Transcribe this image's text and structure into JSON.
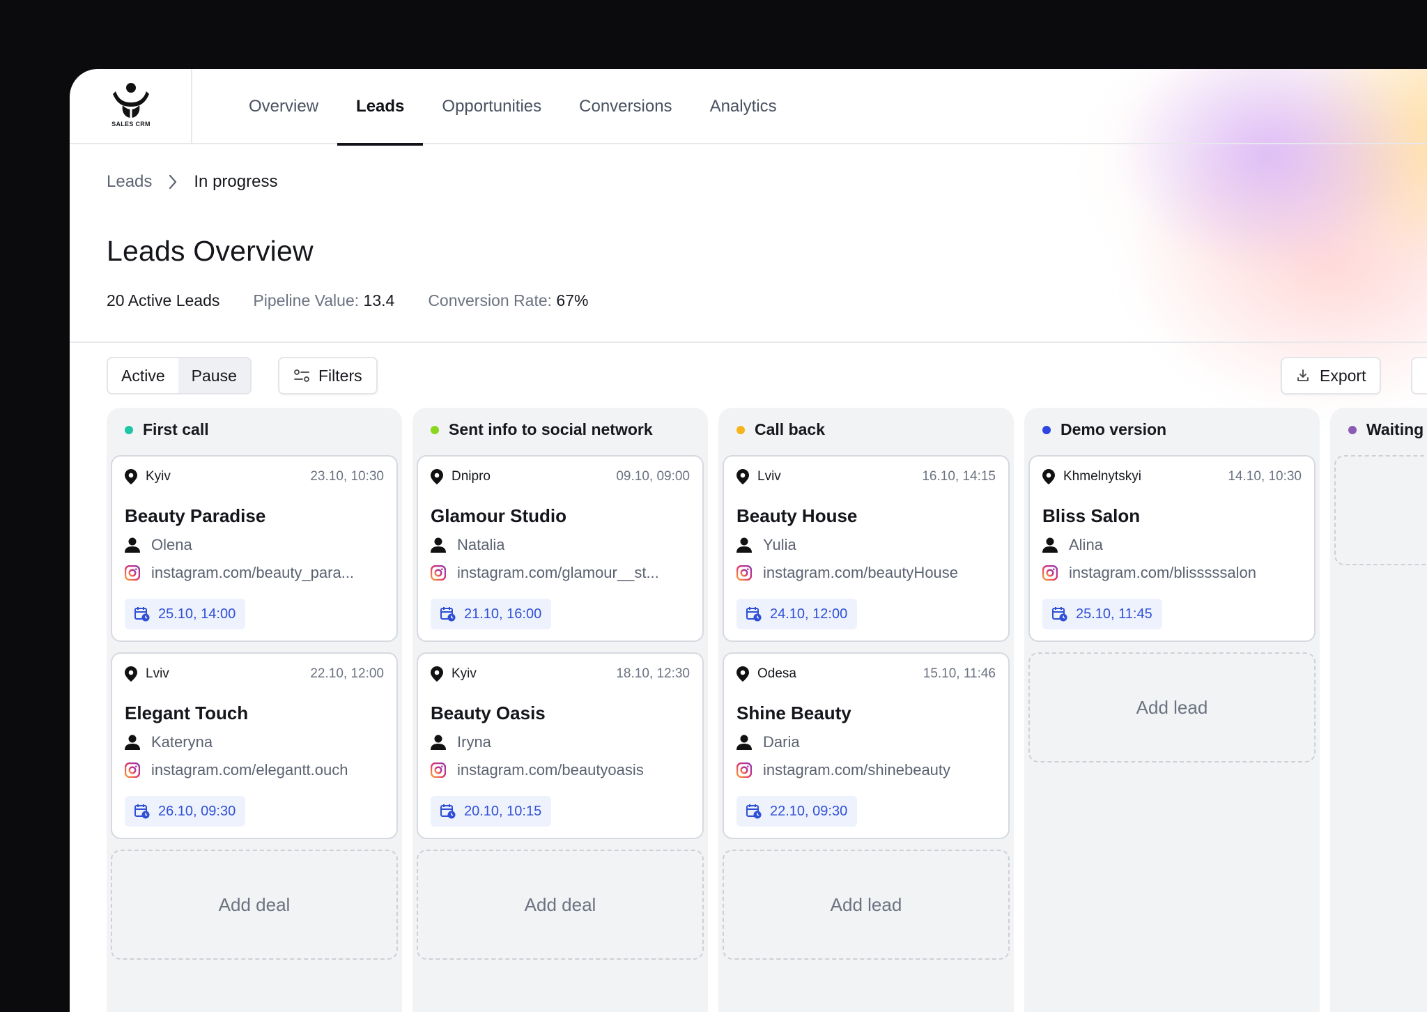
{
  "app": {
    "logo_text": "SALES CRM"
  },
  "nav": {
    "tabs": [
      {
        "label": "Overview"
      },
      {
        "label": "Leads",
        "active": true
      },
      {
        "label": "Opportunities"
      },
      {
        "label": "Conversions"
      },
      {
        "label": "Analytics"
      }
    ]
  },
  "breadcrumb": {
    "root": "Leads",
    "current": "In progress"
  },
  "page": {
    "title": "Leads Overview"
  },
  "stats": {
    "active_leads": "20 Active Leads",
    "pipeline_label": "Pipeline Value:",
    "pipeline_value": "13.4",
    "conversion_label": "Conversion Rate:",
    "conversion_value": "67%"
  },
  "toolbar": {
    "segment": {
      "active": "Active",
      "pause": "Pause"
    },
    "filters": "Filters",
    "export": "Export"
  },
  "colors": {
    "first_call": "#1cc6a6",
    "sent_info": "#8ad61c",
    "call_back": "#f5b51a",
    "demo_version": "#2f44e0",
    "waiting": "#8c5bb5",
    "badge_text": "#2f4fd6"
  },
  "columns": [
    {
      "title": "First call",
      "cards": [
        {
          "city": "Kyiv",
          "date": "23.10, 10:30",
          "name": "Beauty Paradise",
          "contact": "Olena",
          "instagram": "instagram.com/beauty_para...",
          "meeting": "25.10, 14:00"
        },
        {
          "city": "Lviv",
          "date": "22.10, 12:00",
          "name": "Elegant Touch",
          "contact": "Kateryna",
          "instagram": "instagram.com/elegantt.ouch",
          "meeting": "26.10, 09:30"
        }
      ],
      "add_label": "Add deal"
    },
    {
      "title": "Sent info to social network",
      "cards": [
        {
          "city": "Dnipro",
          "date": "09.10, 09:00",
          "name": "Glamour Studio",
          "contact": "Natalia",
          "instagram": "instagram.com/glamour__st...",
          "meeting": "21.10, 16:00"
        },
        {
          "city": "Kyiv",
          "date": "18.10, 12:30",
          "name": "Beauty Oasis",
          "contact": "Iryna",
          "instagram": "instagram.com/beautyoasis",
          "meeting": "20.10, 10:15"
        }
      ],
      "add_label": "Add deal"
    },
    {
      "title": "Call back",
      "cards": [
        {
          "city": "Lviv",
          "date": "16.10, 14:15",
          "name": "Beauty House",
          "contact": "Yulia",
          "instagram": "instagram.com/beautyHouse",
          "meeting": "24.10, 12:00"
        },
        {
          "city": "Odesa",
          "date": "15.10, 11:46",
          "name": "Shine Beauty",
          "contact": "Daria",
          "instagram": "instagram.com/shinebeauty",
          "meeting": "22.10, 09:30"
        }
      ],
      "add_label": "Add lead"
    },
    {
      "title": "Demo version",
      "cards": [
        {
          "city": "Khmelnytskyi",
          "date": "14.10, 10:30",
          "name": "Bliss Salon",
          "contact": "Alina",
          "instagram": "instagram.com/blisssssalon",
          "meeting": "25.10, 11:45"
        }
      ],
      "add_label": "Add lead"
    },
    {
      "title": "Waiting",
      "cards": []
    }
  ]
}
